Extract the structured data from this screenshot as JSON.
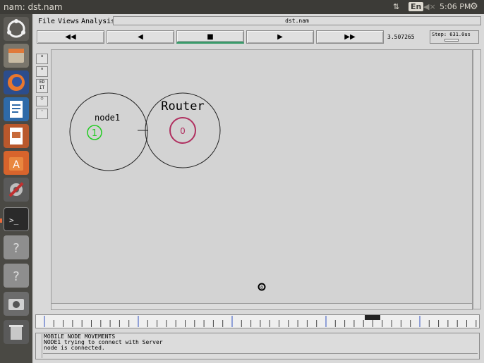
{
  "system_bar": {
    "window_title": "nam: dst.nam",
    "keyboard_layout": "En",
    "clock": "5:06 PM",
    "icons": [
      "network-arrows-icon",
      "keyboard-layout-icon",
      "volume-muted-icon",
      "gear-icon"
    ]
  },
  "launcher": {
    "items": [
      "ubuntu-logo",
      "files",
      "firefox",
      "writer",
      "impress",
      "software-center",
      "system-settings",
      "terminal",
      "unknown-app",
      "unknown-app",
      "screenshot",
      "trash"
    ]
  },
  "menubar": {
    "file": "File",
    "views": "Views",
    "analysis": "Analysis",
    "filename": "dst.nam"
  },
  "controls": {
    "rewind": "◀◀",
    "back": "◀",
    "stop": "■",
    "play": "▶",
    "fast_forward": "▶▶",
    "time": "3.507265",
    "step": "Step: 631.0us"
  },
  "tools": {
    "edit_label": "ED IT"
  },
  "canvas": {
    "nodes": [
      {
        "label": "node1",
        "id": "1",
        "color": "#22cc22"
      },
      {
        "label": "Router",
        "id": "0",
        "color": "#b03060"
      },
      {
        "label": "",
        "id": "0",
        "color": "#000000"
      }
    ]
  },
  "annotation": {
    "lines": [
      "MOBILE NODE MOVEMENTS",
      "NODE1 trying to connect with Server",
      "node is connected."
    ]
  }
}
